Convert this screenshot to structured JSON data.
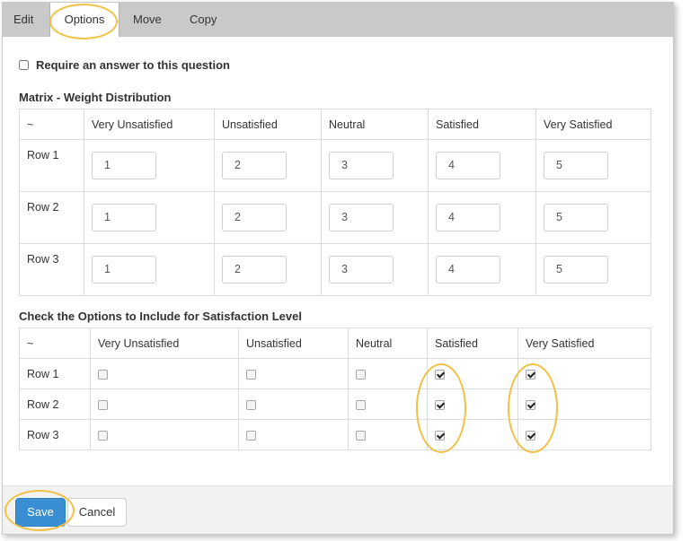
{
  "tabs": [
    {
      "label": "Edit",
      "active": false
    },
    {
      "label": "Options",
      "active": true
    },
    {
      "label": "Move",
      "active": false
    },
    {
      "label": "Copy",
      "active": false
    }
  ],
  "require_answer": {
    "label": "Require an answer to this question",
    "checked": false
  },
  "matrix": {
    "title": "Matrix - Weight Distribution",
    "corner": "~",
    "columns": [
      "Very Unsatisfied",
      "Unsatisfied",
      "Neutral",
      "Satisfied",
      "Very Satisfied"
    ],
    "rows": [
      {
        "label": "Row 1",
        "values": [
          "1",
          "2",
          "3",
          "4",
          "5"
        ]
      },
      {
        "label": "Row 2",
        "values": [
          "1",
          "2",
          "3",
          "4",
          "5"
        ]
      },
      {
        "label": "Row 3",
        "values": [
          "1",
          "2",
          "3",
          "4",
          "5"
        ]
      }
    ]
  },
  "options": {
    "title": "Check the Options to Include for Satisfaction Level",
    "corner": "~",
    "columns": [
      "Very Unsatisfied",
      "Unsatisfied",
      "Neutral",
      "Satisfied",
      "Very Satisfied"
    ],
    "rows": [
      {
        "label": "Row 1",
        "checked": [
          false,
          false,
          false,
          true,
          true
        ]
      },
      {
        "label": "Row 2",
        "checked": [
          false,
          false,
          false,
          true,
          true
        ]
      },
      {
        "label": "Row 3",
        "checked": [
          false,
          false,
          false,
          true,
          true
        ]
      }
    ]
  },
  "footer": {
    "save_label": "Save",
    "cancel_label": "Cancel"
  },
  "colors": {
    "highlight": "#f2c144",
    "save_button": "#3a8fd4",
    "tab_bar": "#c9c9c9"
  }
}
